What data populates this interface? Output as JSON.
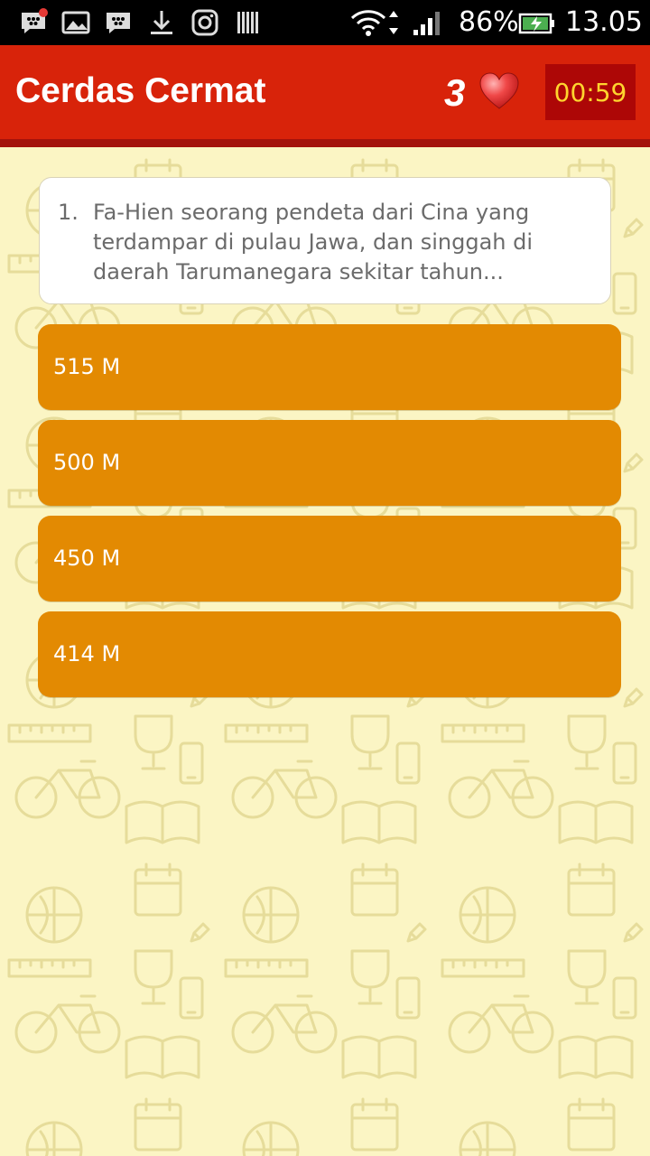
{
  "status_bar": {
    "icons": [
      "bbm-notification-icon",
      "gallery-icon",
      "bbm-icon",
      "download-icon",
      "instagram-icon",
      "barcode-icon"
    ],
    "battery_percent": "86%",
    "time": "13.05"
  },
  "app_bar": {
    "title": "Cerdas Cermat",
    "lives": "3",
    "timer": "00:59",
    "heart_icon": "heart-icon"
  },
  "colors": {
    "app_bar": "#d8230a",
    "timer_bg": "#ad0706",
    "timer_text": "#ffd52e",
    "answer_bg": "#e38a02",
    "background": "#fbf5c4"
  },
  "question": {
    "number": "1.",
    "text": "Fa-Hien seorang pendeta dari Cina yang terdampar di pulau Jawa, dan singgah di daerah Tarumanegara sekitar tahun..."
  },
  "answers": [
    {
      "label": "515 M"
    },
    {
      "label": "500 M"
    },
    {
      "label": "450 M"
    },
    {
      "label": "414 M"
    }
  ]
}
